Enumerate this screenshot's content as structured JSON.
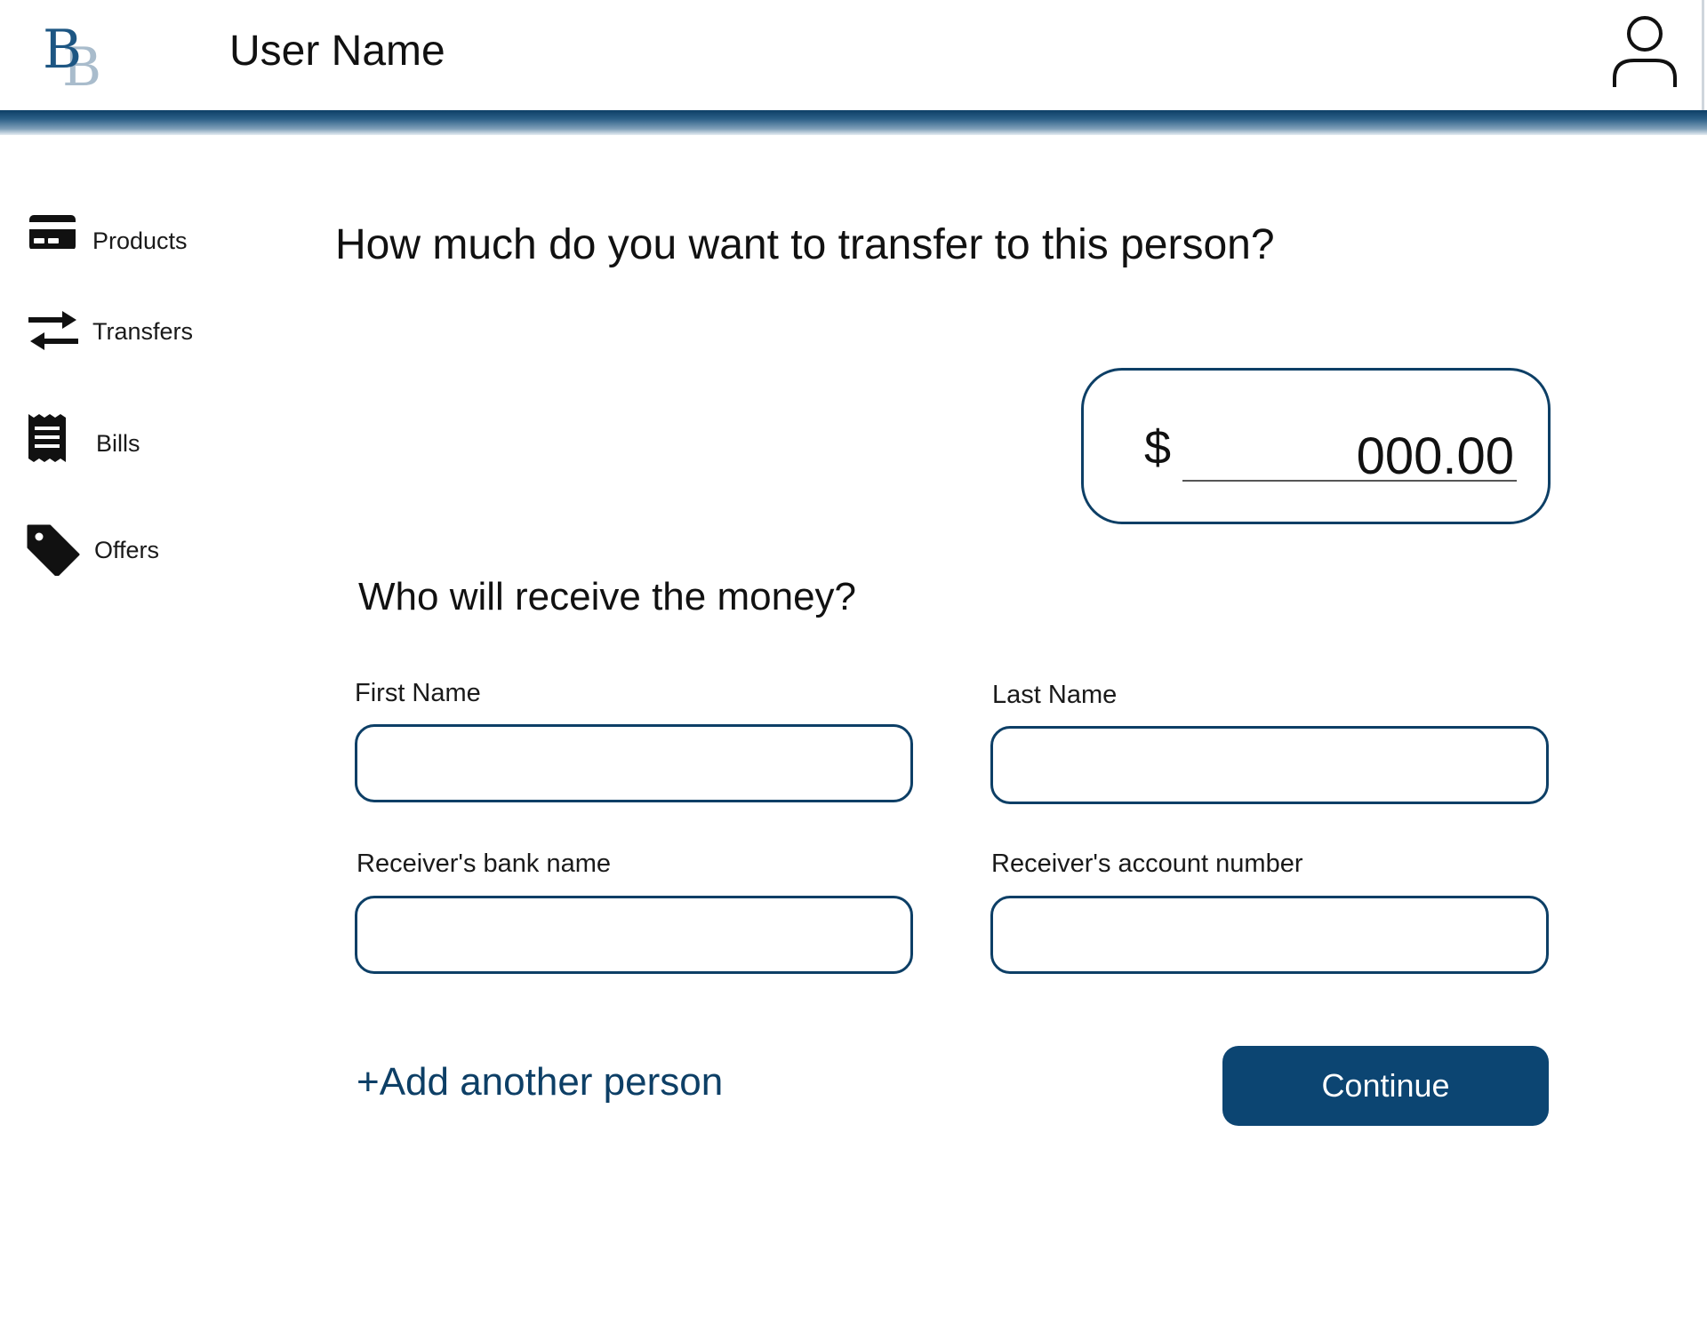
{
  "header": {
    "logo_letter_primary": "B",
    "logo_letter_secondary": "B",
    "user_name": "User Name",
    "profile_icon": "user-outline-icon"
  },
  "sidebar": {
    "items": [
      {
        "label": "Products",
        "icon": "credit-card-icon"
      },
      {
        "label": "Transfers",
        "icon": "transfer-arrows-icon"
      },
      {
        "label": "Bills",
        "icon": "receipt-icon"
      },
      {
        "label": "Offers",
        "icon": "tag-icon"
      }
    ]
  },
  "main": {
    "title": "How much do you want to transfer to this person?",
    "amount": {
      "currency_symbol": "$",
      "value": "000.00"
    },
    "subtitle": "Who will receive the money?",
    "fields": {
      "first_name": {
        "label": "First Name",
        "value": ""
      },
      "last_name": {
        "label": "Last Name",
        "value": ""
      },
      "bank_name": {
        "label": "Receiver's bank name",
        "value": ""
      },
      "account_number": {
        "label": "Receiver's account number",
        "value": ""
      }
    },
    "add_person_label": "+Add another person",
    "continue_label": "Continue"
  },
  "colors": {
    "brand_dark": "#0d3f66",
    "button": "#0c4572",
    "logo_light": "#a9bccc"
  }
}
